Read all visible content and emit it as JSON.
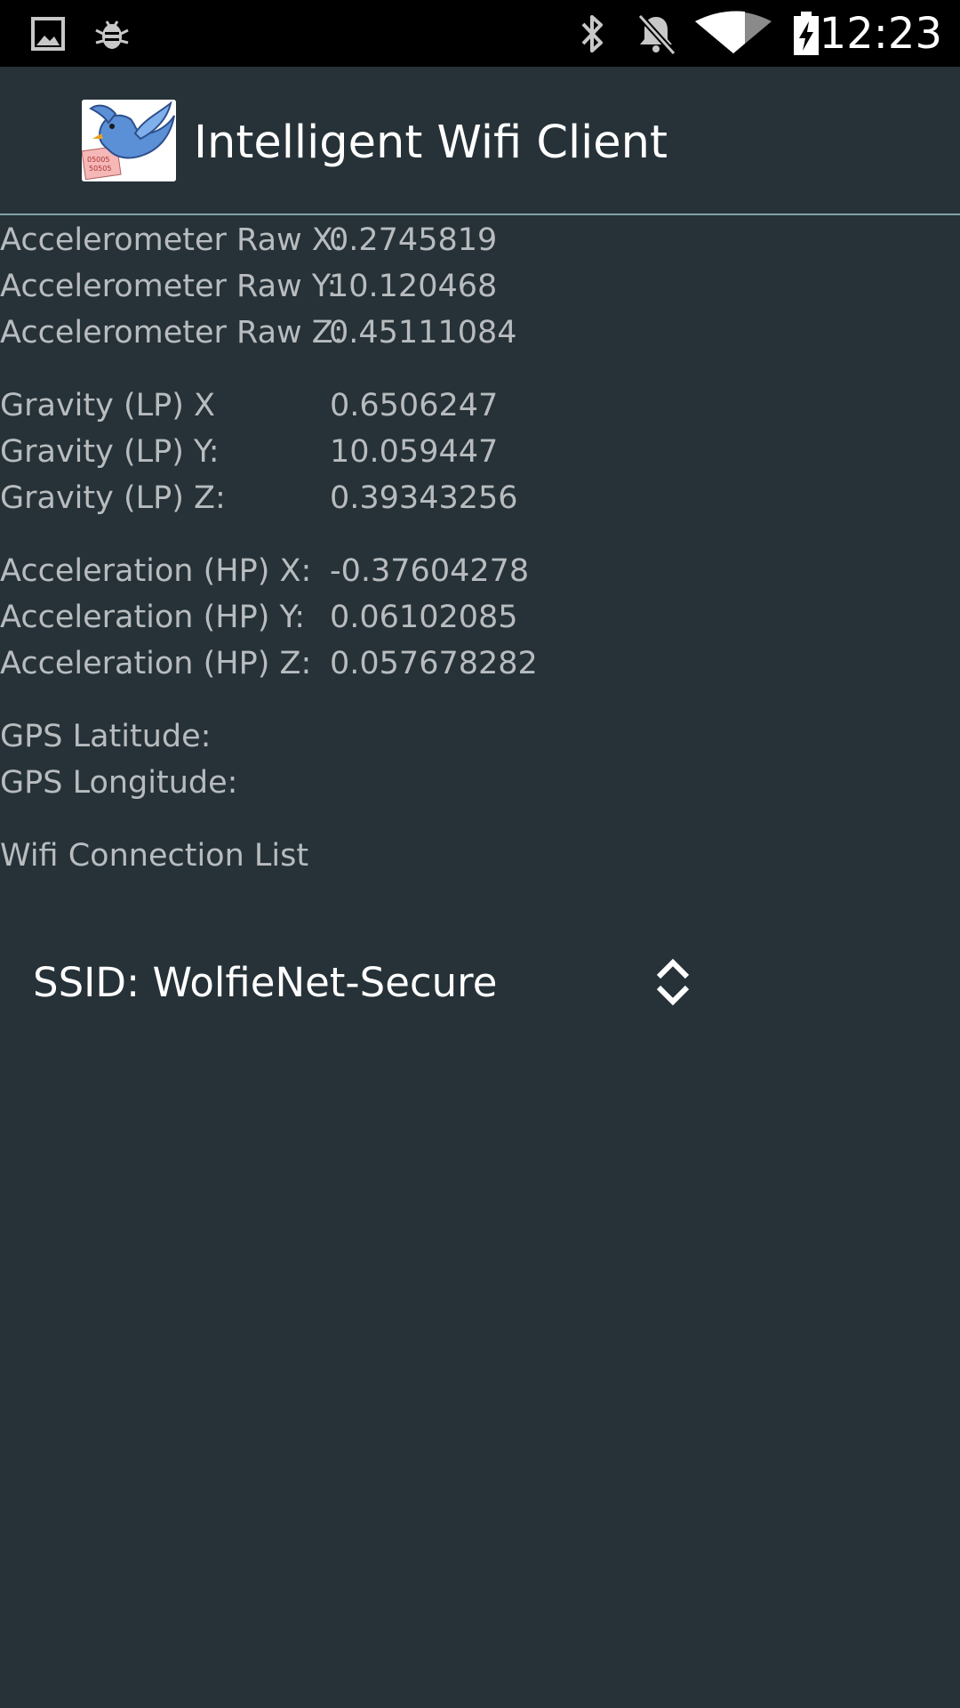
{
  "status_bar": {
    "time": "12:23",
    "left_icons": [
      "image-icon",
      "bug-icon"
    ],
    "right_icons": [
      "bluetooth-icon",
      "notifications-off-icon",
      "wifi-icon",
      "battery-charging-icon"
    ]
  },
  "app_bar": {
    "title": "Intelligent Wifi Client",
    "logo": "bird-logo-icon"
  },
  "accelerometer_raw": [
    {
      "label": "Accelerometer Raw X:",
      "value": "0.2745819"
    },
    {
      "label": "Accelerometer Raw Y:",
      "value": "10.120468"
    },
    {
      "label": "Accelerometer Raw Z:",
      "value": "0.45111084"
    }
  ],
  "gravity": [
    {
      "label": "Gravity (LP) X",
      "value": "0.6506247"
    },
    {
      "label": "Gravity (LP) Y:",
      "value": "10.059447"
    },
    {
      "label": "Gravity (LP) Z:",
      "value": "0.39343256"
    }
  ],
  "acceleration": [
    {
      "label": "Acceleration (HP) X:",
      "value": "-0.37604278"
    },
    {
      "label": "Acceleration (HP) Y:",
      "value": "0.06102085"
    },
    {
      "label": "Acceleration (HP) Z:",
      "value": "0.057678282"
    }
  ],
  "gps": {
    "latitude_label": "GPS Latitude:",
    "longitude_label": "GPS Longitude:"
  },
  "wifi": {
    "list_label": "Wifi Connection List",
    "selected": "SSID: WolfieNet-Secure"
  },
  "colors": {
    "background": "#263238",
    "status_bar": "#000000",
    "divider": "#7ea3aa",
    "text_secondary": "#b8bcbf",
    "text_primary": "#ffffff"
  }
}
